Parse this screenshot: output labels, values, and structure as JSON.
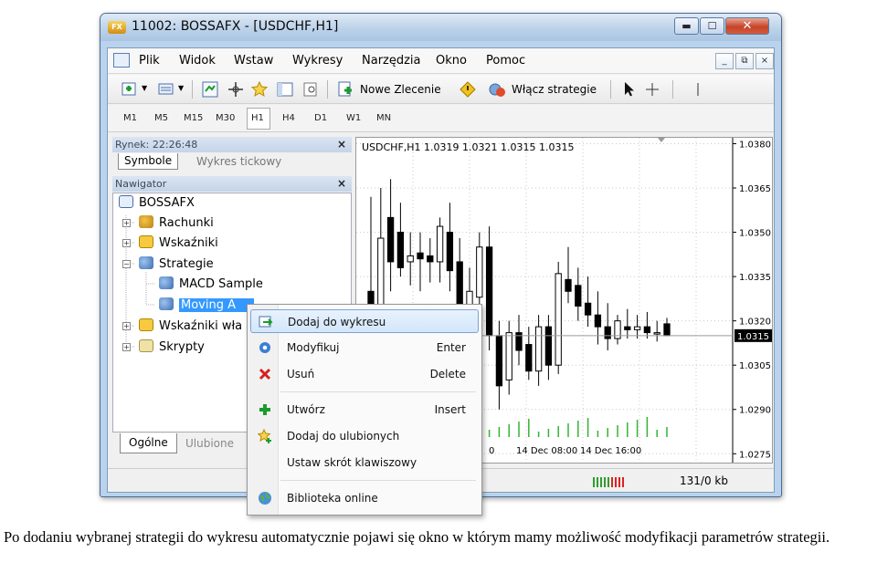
{
  "window": {
    "title": "11002: BOSSAFX - [USDCHF,H1]",
    "app_icon_text": "FX",
    "min_glyph": "▬",
    "max_glyph": "☐",
    "close_glyph": "✕"
  },
  "menubar": {
    "items": [
      "Plik",
      "Widok",
      "Wstaw",
      "Wykresy",
      "Narzędzia",
      "Okno",
      "Pomoc"
    ],
    "mdi": [
      "_",
      "⧉",
      "×"
    ]
  },
  "toolbar": {
    "new_order_label": "Nowe Zlecenie",
    "strategies_label": "Włącz strategie"
  },
  "timeframes": [
    "M1",
    "M5",
    "M15",
    "M30",
    "H1",
    "H4",
    "D1",
    "W1",
    "MN"
  ],
  "market_watch": {
    "header": "Rynek: 22:26:48",
    "tabs": [
      "Symbole",
      "Wykres tickowy"
    ]
  },
  "navigator": {
    "header": "Nawigator",
    "items": [
      {
        "label": "BOSSAFX"
      },
      {
        "label": "Rachunki"
      },
      {
        "label": "Wskaźniki"
      },
      {
        "label": "Strategie"
      },
      {
        "label": "MACD Sample"
      },
      {
        "label": "Moving A"
      },
      {
        "label": "Wskaźniki wła"
      },
      {
        "label": "Skrypty"
      }
    ],
    "tabs": [
      "Ogólne",
      "Ulubione"
    ],
    "close_glyph": "×"
  },
  "chart": {
    "header": "USDCHF,H1  1.0319 1.0321 1.0315 1.0315",
    "price_labels": [
      "1.0380",
      "1.0365",
      "1.0350",
      "1.0335",
      "1.0320",
      "1.0305",
      "1.0290",
      "1.0275"
    ],
    "current_price": "1.0315",
    "time_labels": [
      "0",
      "14 Dec 08:00",
      "14 Dec 16:00"
    ],
    "colors": {
      "bull": "#ffffff",
      "bear": "#000000",
      "volume": "#32b432",
      "grid": "#c8c8c8"
    }
  },
  "chart_data": {
    "type": "candlestick",
    "title": "USDCHF,H1",
    "ohlc_header": [
      "1.0319",
      "1.0321",
      "1.0315",
      "1.0315"
    ],
    "ylim": [
      1.0272,
      1.0382
    ],
    "price_ticks": [
      1.038,
      1.0365,
      1.035,
      1.0335,
      1.032,
      1.0305,
      1.029,
      1.0275
    ],
    "current_price": 1.0315,
    "x_tick_labels": [
      "0",
      "14 Dec 08:00",
      "14 Dec 16:00"
    ],
    "candles": [
      {
        "o": 1.033,
        "h": 1.0362,
        "l": 1.0305,
        "c": 1.031
      },
      {
        "o": 1.0318,
        "h": 1.0365,
        "l": 1.0305,
        "c": 1.0348
      },
      {
        "o": 1.0355,
        "h": 1.0368,
        "l": 1.033,
        "c": 1.034
      },
      {
        "o": 1.035,
        "h": 1.036,
        "l": 1.0335,
        "c": 1.0338
      },
      {
        "o": 1.034,
        "h": 1.035,
        "l": 1.0332,
        "c": 1.0342
      },
      {
        "o": 1.0343,
        "h": 1.035,
        "l": 1.033,
        "c": 1.0341
      },
      {
        "o": 1.0342,
        "h": 1.0348,
        "l": 1.0333,
        "c": 1.034
      },
      {
        "o": 1.034,
        "h": 1.0355,
        "l": 1.0333,
        "c": 1.0352
      },
      {
        "o": 1.035,
        "h": 1.036,
        "l": 1.033,
        "c": 1.0337
      },
      {
        "o": 1.034,
        "h": 1.0348,
        "l": 1.032,
        "c": 1.0325
      },
      {
        "o": 1.0325,
        "h": 1.0338,
        "l": 1.0312,
        "c": 1.033
      },
      {
        "o": 1.0328,
        "h": 1.035,
        "l": 1.032,
        "c": 1.0345
      },
      {
        "o": 1.0345,
        "h": 1.0352,
        "l": 1.031,
        "c": 1.0315
      },
      {
        "o": 1.0315,
        "h": 1.032,
        "l": 1.029,
        "c": 1.0298
      },
      {
        "o": 1.03,
        "h": 1.032,
        "l": 1.0295,
        "c": 1.0316
      },
      {
        "o": 1.0316,
        "h": 1.0322,
        "l": 1.0305,
        "c": 1.031
      },
      {
        "o": 1.0312,
        "h": 1.0318,
        "l": 1.03,
        "c": 1.0303
      },
      {
        "o": 1.0303,
        "h": 1.0322,
        "l": 1.0298,
        "c": 1.0318
      },
      {
        "o": 1.0318,
        "h": 1.0322,
        "l": 1.03,
        "c": 1.0305
      },
      {
        "o": 1.0305,
        "h": 1.034,
        "l": 1.0302,
        "c": 1.0336
      },
      {
        "o": 1.0334,
        "h": 1.0345,
        "l": 1.0326,
        "c": 1.033
      },
      {
        "o": 1.0332,
        "h": 1.0338,
        "l": 1.032,
        "c": 1.0325
      },
      {
        "o": 1.0326,
        "h": 1.0335,
        "l": 1.0318,
        "c": 1.0322
      },
      {
        "o": 1.0322,
        "h": 1.033,
        "l": 1.0312,
        "c": 1.0318
      },
      {
        "o": 1.0318,
        "h": 1.0326,
        "l": 1.031,
        "c": 1.0314
      },
      {
        "o": 1.0314,
        "h": 1.0322,
        "l": 1.0312,
        "c": 1.032
      },
      {
        "o": 1.0318,
        "h": 1.0324,
        "l": 1.0314,
        "c": 1.0317
      },
      {
        "o": 1.0317,
        "h": 1.0322,
        "l": 1.0314,
        "c": 1.0318
      },
      {
        "o": 1.0318,
        "h": 1.0323,
        "l": 1.0314,
        "c": 1.0316
      },
      {
        "o": 1.0316,
        "h": 1.032,
        "l": 1.0313,
        "c": 1.0316
      },
      {
        "o": 1.0319,
        "h": 1.0321,
        "l": 1.0315,
        "c": 1.0315
      }
    ]
  },
  "context_menu": {
    "items": [
      {
        "label": "Dodaj do wykresu",
        "shortcut": ""
      },
      {
        "label": "Modyfikuj",
        "shortcut": "Enter"
      },
      {
        "label": "Usuń",
        "shortcut": "Delete"
      },
      {
        "label": "Utwórz",
        "shortcut": "Insert"
      },
      {
        "label": "Dodaj do ulubionych",
        "shortcut": ""
      },
      {
        "label": "Ustaw skrót klawiszowy",
        "shortcut": ""
      },
      {
        "label": "Biblioteka online",
        "shortcut": ""
      }
    ]
  },
  "statusbar": {
    "traffic": "131/0 kb"
  },
  "caption": "Po dodaniu wybranej strategii do wykresu automatycznie pojawi się okno w którym mamy możliwość modyfikacji parametrów strategii."
}
